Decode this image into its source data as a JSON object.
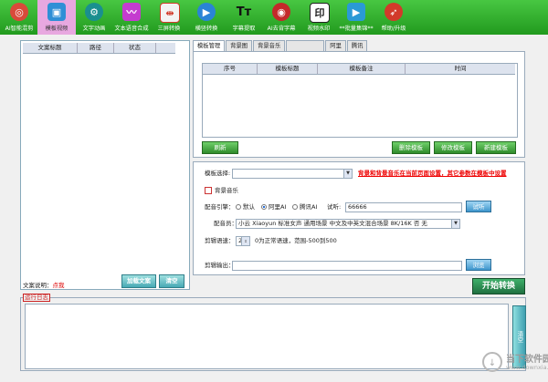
{
  "toolbar": {
    "items": [
      {
        "label": "AI智能混剪",
        "icon": "basketball-icon",
        "color": "#d94a3a",
        "glyph": "◎"
      },
      {
        "label": "模板视频",
        "icon": "tv-icon",
        "color": "#2f8fd6",
        "glyph": "▣"
      },
      {
        "label": "文字动画",
        "icon": "gear-icon",
        "color": "#1a8f8f",
        "glyph": "⚙"
      },
      {
        "label": "文本语音合成",
        "icon": "waveform-icon",
        "color": "#c43ccf",
        "glyph": "〰"
      },
      {
        "label": "三屏转换",
        "icon": "split-screen-icon",
        "color": "#d23a2a",
        "glyph": "⇹"
      },
      {
        "label": "横竖转换",
        "icon": "play-icon",
        "color": "#2a84d6",
        "glyph": "▶"
      },
      {
        "label": "字幕提取",
        "icon": "text-icon",
        "color": "#222222",
        "glyph": "Tт"
      },
      {
        "label": "AI去背字幕",
        "icon": "record-icon",
        "color": "#c42a2a",
        "glyph": "◉"
      },
      {
        "label": "视频水印",
        "icon": "seal-icon",
        "color": "#2a2a2a",
        "glyph": "印"
      },
      {
        "label": "**批量集锦**",
        "icon": "video-camera-icon",
        "color": "#2a9ad6",
        "glyph": "▶"
      },
      {
        "label": "帮助/升级",
        "icon": "rocket-icon",
        "color": "#d23a2a",
        "glyph": "➶"
      }
    ]
  },
  "left": {
    "columns": [
      "文案标题",
      "路径",
      "状态"
    ],
    "footer_label": "文案说明：",
    "footer_link": "点我",
    "load_button": "加载文案",
    "clear_button": "清空"
  },
  "tabs": [
    "模板管理",
    "背景图",
    "背景音乐",
    "",
    "阿里",
    "腾讯"
  ],
  "template_table": {
    "columns": [
      "序号",
      "模板标题",
      "模板备注",
      "时间"
    ]
  },
  "template_buttons": {
    "refresh": "刷新",
    "delete": "删除模板",
    "edit": "修改模板",
    "new": "新建模板"
  },
  "form": {
    "template_select_label": "模板选择:",
    "template_select_value": "",
    "bg_warning": "背景和背景音乐在当前页面设置，其它参数在模板中设置",
    "bg_music_label": "背景音乐",
    "engine_label": "配音引擎：",
    "engine_options": [
      "默认",
      "阿里AI",
      "腾讯AI"
    ],
    "engine_selected": "阿里AI",
    "listen_label": "试听:",
    "listen_value": "66666",
    "listen_button": "试听",
    "voice_label": "配音员：",
    "voice_value": "小云 Xiaoyun 标准女声 通用场景 中文及中英文混合场景 8K/16K 否 无",
    "speed_label": "剪辑语速：",
    "speed_value": "2",
    "speed_hint": "0为正常语速，范围-500到500",
    "output_label": "剪辑输出：",
    "output_value": "",
    "browse_button": "浏览"
  },
  "start_button": "开始转换",
  "log": {
    "label": "运行日志",
    "clear_button": "清空"
  },
  "watermark": {
    "title": "当下软件园",
    "subtitle": "www.downxia.com"
  }
}
